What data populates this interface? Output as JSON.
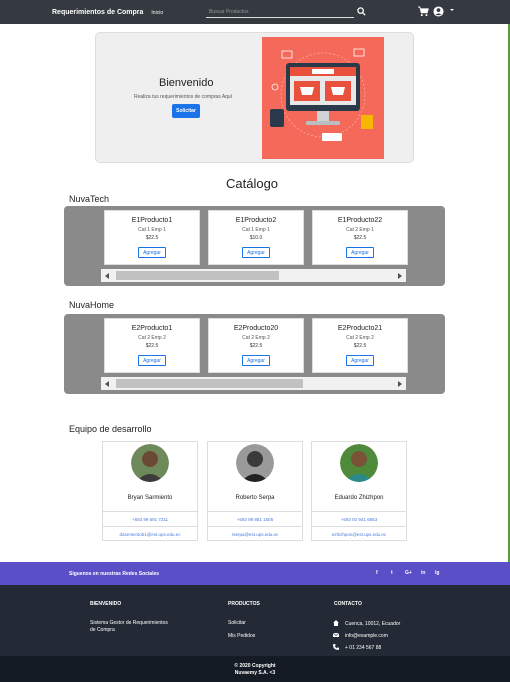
{
  "nav": {
    "brand": "Requerimientos de Compra",
    "home": "Inicio",
    "search_placeholder": "Buscar Productos"
  },
  "hero": {
    "title": "Bienvenido",
    "subtitle": "Realiza tus requerimientos de compras Aquí",
    "button": "Solicitar"
  },
  "catalog": {
    "title": "Catálogo",
    "sections": [
      {
        "name": "NuvaTech",
        "products": [
          {
            "name": "E1Producto1",
            "cat": "Cat 1 Emp 1",
            "price": "$22.5",
            "action": "Agregar"
          },
          {
            "name": "E1Producto2",
            "cat": "Cat 1 Emp 1",
            "price": "$10.0",
            "action": "Agregar"
          },
          {
            "name": "E1Producto22",
            "cat": "Cat 2 Emp 1",
            "price": "$22.5",
            "action": "Agregar"
          }
        ],
        "scroll_fraction": 0.68
      },
      {
        "name": "NuvaHome",
        "products": [
          {
            "name": "E2Producto1",
            "cat": "Cat 2 Emp 2",
            "price": "$22.5",
            "action": "Agregar"
          },
          {
            "name": "E2Producto20",
            "cat": "Cat 2 Emp 2",
            "price": "$22.5",
            "action": "Agregar"
          },
          {
            "name": "E2Producto21",
            "cat": "Cat 2 Emp 2",
            "price": "$22.5",
            "action": "Agregar"
          }
        ],
        "scroll_fraction": 0.78
      }
    ]
  },
  "team": {
    "title": "Equipo de desarrollo",
    "members": [
      {
        "name": "Bryan Sarmiento",
        "phone": "+593 99 691 7211",
        "email": "dsarmientob1@est.ups.edu.ec"
      },
      {
        "name": "Roberto Serpa",
        "phone": "+593 99 881 1505",
        "email": "rserpa@est.ups.edu.ec"
      },
      {
        "name": "Eduardo Zhizhpon",
        "phone": "+593 93 941 6853",
        "email": "ezhizhpon@est.ups.edu.ec"
      }
    ]
  },
  "social": {
    "text": "Siguenos en nuestras Redes Sociales",
    "icons": [
      "f",
      "t",
      "G+",
      "in",
      "ig"
    ]
  },
  "footer": {
    "col1_title": "BIENVENIDO",
    "col1_line1": "Sistema Gestor de Requerimientos",
    "col1_line2": "de Compra",
    "col2_title": "PRODUCTOS",
    "col2_item1": "Solicitar",
    "col2_item2": "Mis Pedidos",
    "col3_title": "CONTACTO",
    "address": "Cuenca, 10012, Ecuador",
    "email": "info@example.com",
    "phone": "+ 01 234 567 88"
  },
  "copyright": {
    "line1": "© 2020 Copyright",
    "line2": "Nuvaemy S.A. <3"
  },
  "colors": {
    "navbar": "#343a40",
    "primary": "#1a73e8",
    "social_bar": "#5b4fc7",
    "footer": "#232a35"
  }
}
